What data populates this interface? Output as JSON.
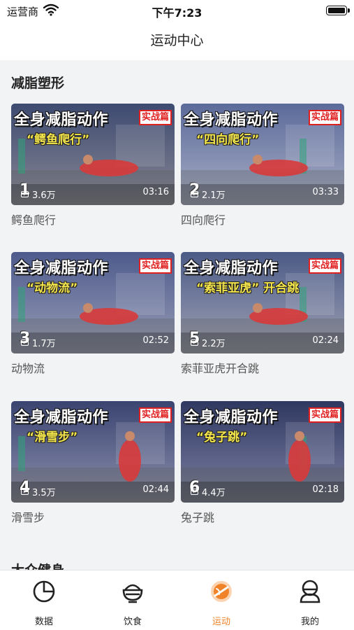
{
  "status_bar": {
    "carrier": "运营商",
    "time": "下午7:23",
    "wifi_icon": "wifi-icon",
    "battery_icon": "battery-icon"
  },
  "nav": {
    "title": "运动中心"
  },
  "sections": [
    {
      "title": "减脂塑形",
      "videos": [
        {
          "headline": "全身减脂动作",
          "tag": "实战篇",
          "subtitle": "“鳄鱼爬行”",
          "rank": "1",
          "plays": "3.6万",
          "duration": "03:16",
          "title": "鳄鱼爬行"
        },
        {
          "headline": "全身减脂动作",
          "tag": "实战篇",
          "subtitle": "“四向爬行”",
          "rank": "2",
          "plays": "2.1万",
          "duration": "03:33",
          "title": "四向爬行"
        },
        {
          "headline": "全身减脂动作",
          "tag": "实战篇",
          "subtitle": "“动物流”",
          "rank": "3",
          "plays": "1.7万",
          "duration": "02:52",
          "title": "动物流"
        },
        {
          "headline": "全身减脂动作",
          "tag": "实战篇",
          "subtitle": "“索菲亚虎” 开合跳",
          "rank": "5",
          "plays": "2.2万",
          "duration": "02:24",
          "title": "索菲亚虎开合跳"
        },
        {
          "headline": "全身减脂动作",
          "tag": "实战篇",
          "subtitle": "“滑雪步”",
          "rank": "4",
          "plays": "3.5万",
          "duration": "02:44",
          "title": "滑雪步"
        },
        {
          "headline": "全身减脂动作",
          "tag": "实战篇",
          "subtitle": "“兔子跳”",
          "rank": "6",
          "plays": "4.4万",
          "duration": "02:18",
          "title": "兔子跳"
        }
      ]
    },
    {
      "title": "大众健身"
    }
  ],
  "tabs": [
    {
      "label": "数据",
      "icon": "pie-chart-icon",
      "active": false
    },
    {
      "label": "饮食",
      "icon": "bowl-icon",
      "active": false
    },
    {
      "label": "运动",
      "icon": "sport-icon",
      "active": true
    },
    {
      "label": "我的",
      "icon": "user-icon",
      "active": false
    }
  ],
  "colors": {
    "accent": "#f0832a",
    "tag_red": "#e02020",
    "subtitle_yellow": "#f5e64a"
  }
}
